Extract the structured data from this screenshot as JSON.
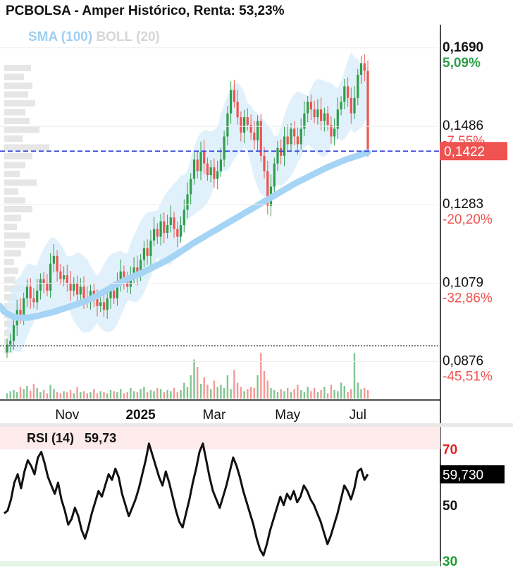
{
  "title": "PCBOLSA - Amper Histórico, Renta: 53,23%",
  "legend": {
    "sma": "SMA (100)",
    "boll": "BOLL (20)"
  },
  "colors": {
    "up": "#2e9e49",
    "down": "#ef5350",
    "sma": "#a6d4f4",
    "band": "#d7ecfb",
    "last_price": "#ef5350",
    "dashed": "#3344dd"
  },
  "chart_data": [
    {
      "type": "candlestick",
      "y_min": 0.078,
      "y_max": 0.175,
      "last_price": "0,1422",
      "reference_price": 0.0917,
      "price_levels": [
        {
          "price": 0.169,
          "label": "0,1690",
          "pct": "5,09%",
          "kind": "up"
        },
        {
          "price": 0.1486,
          "label": "0,1486",
          "pct": "-7,55%",
          "kind": "down"
        },
        {
          "price": 0.1283,
          "label": "0,1283",
          "pct": "-20,20%",
          "kind": "down"
        },
        {
          "price": 0.1079,
          "label": "0,1079",
          "pct": "-32,86%",
          "kind": "down"
        },
        {
          "price": 0.0876,
          "label": "0,0876",
          "pct": "-45,51%",
          "kind": "down"
        }
      ],
      "x_labels": [
        {
          "label": "Nov",
          "index": 18,
          "bold": false
        },
        {
          "label": "2025",
          "index": 40,
          "bold": true
        },
        {
          "label": "Mar",
          "index": 62,
          "bold": false
        },
        {
          "label": "May",
          "index": 84,
          "bold": false
        },
        {
          "label": "Jul",
          "index": 105,
          "bold": false
        }
      ],
      "close": [
        0.092,
        0.093,
        0.097,
        0.101,
        0.099,
        0.104,
        0.107,
        0.104,
        0.103,
        0.106,
        0.109,
        0.108,
        0.106,
        0.113,
        0.115,
        0.111,
        0.109,
        0.11,
        0.108,
        0.106,
        0.108,
        0.105,
        0.107,
        0.104,
        0.103,
        0.106,
        0.104,
        0.102,
        0.103,
        0.101,
        0.104,
        0.106,
        0.104,
        0.108,
        0.111,
        0.109,
        0.107,
        0.11,
        0.112,
        0.11,
        0.114,
        0.117,
        0.115,
        0.119,
        0.122,
        0.12,
        0.124,
        0.121,
        0.123,
        0.125,
        0.122,
        0.12,
        0.123,
        0.127,
        0.131,
        0.135,
        0.14,
        0.137,
        0.142,
        0.139,
        0.136,
        0.138,
        0.135,
        0.137,
        0.14,
        0.146,
        0.152,
        0.158,
        0.155,
        0.151,
        0.147,
        0.151,
        0.149,
        0.147,
        0.145,
        0.15,
        0.141,
        0.137,
        0.128,
        0.133,
        0.139,
        0.143,
        0.141,
        0.146,
        0.144,
        0.148,
        0.146,
        0.144,
        0.148,
        0.152,
        0.155,
        0.153,
        0.151,
        0.153,
        0.15,
        0.152,
        0.149,
        0.146,
        0.148,
        0.153,
        0.155,
        0.159,
        0.156,
        0.152,
        0.156,
        0.162,
        0.165,
        0.163,
        0.1422
      ],
      "sma": [
        0.102,
        0.1005,
        0.0998,
        0.0992,
        0.099,
        0.099,
        0.099,
        0.0992,
        0.0994,
        0.0997,
        0.1,
        0.1003,
        0.1006,
        0.101,
        0.1014,
        0.1018,
        0.1022,
        0.1026,
        0.103,
        0.1035,
        0.104,
        0.1046,
        0.1053,
        0.106,
        0.1067,
        0.1074,
        0.108,
        0.1086,
        0.1092,
        0.1097,
        0.1102,
        0.1107,
        0.1113,
        0.1119,
        0.1125,
        0.1131,
        0.1137,
        0.1144,
        0.1151,
        0.1159,
        0.1167,
        0.1175,
        0.1183,
        0.119,
        0.1197,
        0.1204,
        0.1211,
        0.1218,
        0.1225,
        0.1232,
        0.1239,
        0.1246,
        0.1253,
        0.126,
        0.1267,
        0.1274,
        0.1281,
        0.1288,
        0.1295,
        0.1302,
        0.1309,
        0.1316,
        0.1323,
        0.133,
        0.1337,
        0.1343,
        0.1349,
        0.1355,
        0.1361,
        0.1367,
        0.1373,
        0.1379,
        0.1384,
        0.1389,
        0.1394,
        0.1399,
        0.1403,
        0.1407,
        0.1411,
        0.1415,
        0.1419
      ],
      "sma_start_index": 0,
      "volume": [
        0.1,
        0.14,
        0.16,
        0.12,
        0.22,
        0.18,
        0.24,
        0.15,
        0.28,
        0.2,
        0.12,
        0.16,
        0.1,
        0.26,
        0.18,
        0.12,
        0.1,
        0.14,
        0.12,
        0.16,
        0.1,
        0.22,
        0.12,
        0.14,
        0.1,
        0.12,
        0.18,
        0.1,
        0.14,
        0.12,
        0.1,
        0.16,
        0.14,
        0.12,
        0.18,
        0.1,
        0.12,
        0.2,
        0.14,
        0.12,
        0.18,
        0.22,
        0.12,
        0.16,
        0.14,
        0.2,
        0.18,
        0.12,
        0.16,
        0.14,
        0.2,
        0.12,
        0.16,
        0.3,
        0.22,
        0.44,
        0.74,
        0.6,
        0.28,
        0.4,
        0.26,
        0.18,
        0.34,
        0.22,
        0.26,
        0.2,
        0.44,
        0.18,
        0.54,
        0.3,
        0.22,
        0.14,
        0.18,
        0.22,
        0.2,
        0.44,
        0.86,
        0.52,
        0.34,
        0.2,
        0.16,
        0.12,
        0.18,
        0.14,
        0.2,
        0.12,
        0.18,
        0.26,
        0.16,
        0.12,
        0.22,
        0.14,
        0.2,
        0.12,
        0.16,
        0.22,
        0.1,
        0.26,
        0.16,
        0.14,
        0.3,
        0.24,
        0.12,
        0.18,
        0.86,
        0.3,
        0.18,
        0.2,
        0.16
      ]
    },
    {
      "type": "line",
      "title": "RSI (14)",
      "current_value": "59,73",
      "last_label": "59,730",
      "y_min": 28,
      "y_max": 78,
      "levels": [
        {
          "value": 70,
          "label": "70",
          "color": "#e02020"
        },
        {
          "value": 50,
          "label": "50",
          "color": "#111111"
        },
        {
          "value": 30,
          "label": "30",
          "color": "#1a9e2a"
        }
      ],
      "values": [
        47,
        48,
        52,
        58,
        61,
        56,
        62,
        66,
        64,
        61,
        67,
        69,
        65,
        60,
        57,
        54,
        58,
        52,
        48,
        43,
        45,
        49,
        46,
        41,
        38,
        42,
        47,
        51,
        55,
        53,
        57,
        61,
        59,
        63,
        60,
        54,
        50,
        46,
        49,
        52,
        56,
        61,
        66,
        72,
        68,
        64,
        60,
        57,
        62,
        58,
        53,
        48,
        44,
        42,
        47,
        52,
        58,
        63,
        69,
        72,
        66,
        60,
        55,
        52,
        49,
        53,
        57,
        62,
        67,
        64,
        60,
        55,
        51,
        47,
        43,
        38,
        34,
        32,
        36,
        41,
        45,
        49,
        53,
        50,
        54,
        52,
        55,
        51,
        53,
        57,
        55,
        52,
        50,
        47,
        44,
        40,
        36,
        39,
        43,
        47,
        52,
        57,
        55,
        52,
        56,
        62,
        63,
        59,
        61
      ]
    }
  ]
}
